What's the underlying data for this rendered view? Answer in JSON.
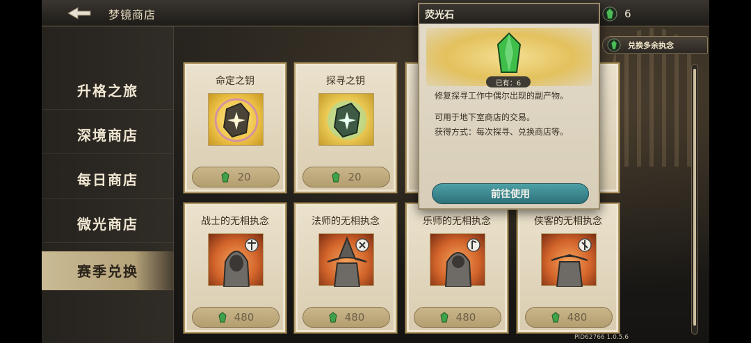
{
  "header": {
    "title": "梦镜商店",
    "currency_count": "6"
  },
  "exchange_button_label": "兑换多余执念",
  "sidebar": {
    "items": [
      {
        "label": "升格之旅"
      },
      {
        "label": "深境商店"
      },
      {
        "label": "每日商店"
      },
      {
        "label": "微光商店"
      },
      {
        "label": "赛季兑换"
      }
    ],
    "active_index": 4
  },
  "cards": [
    {
      "name": "命定之钥",
      "price": "20"
    },
    {
      "name": "探寻之钥",
      "price": "20"
    },
    {
      "name": "战士的无相执念",
      "price": "480"
    },
    {
      "name": "法师的无相执念",
      "price": "480"
    },
    {
      "name": "乐师的无相执念",
      "price": "480"
    },
    {
      "name": "侠客的无相执念",
      "price": "480"
    }
  ],
  "popup": {
    "title": "荧光石",
    "owned": "已有：6",
    "desc1": "修复探寻工作中偶尔出现的副产物。",
    "desc2": "可用于地下室商店的交易。",
    "desc3": "获得方式：每次探寻、兑换商店等。",
    "button": "前往使用"
  },
  "footer": {
    "pid": "PID62766  1.0.5.6"
  },
  "colors": {
    "accent_teal": "#2d7179",
    "card_bg": "#e4dcc6",
    "gem_green": "#3fa24a"
  }
}
